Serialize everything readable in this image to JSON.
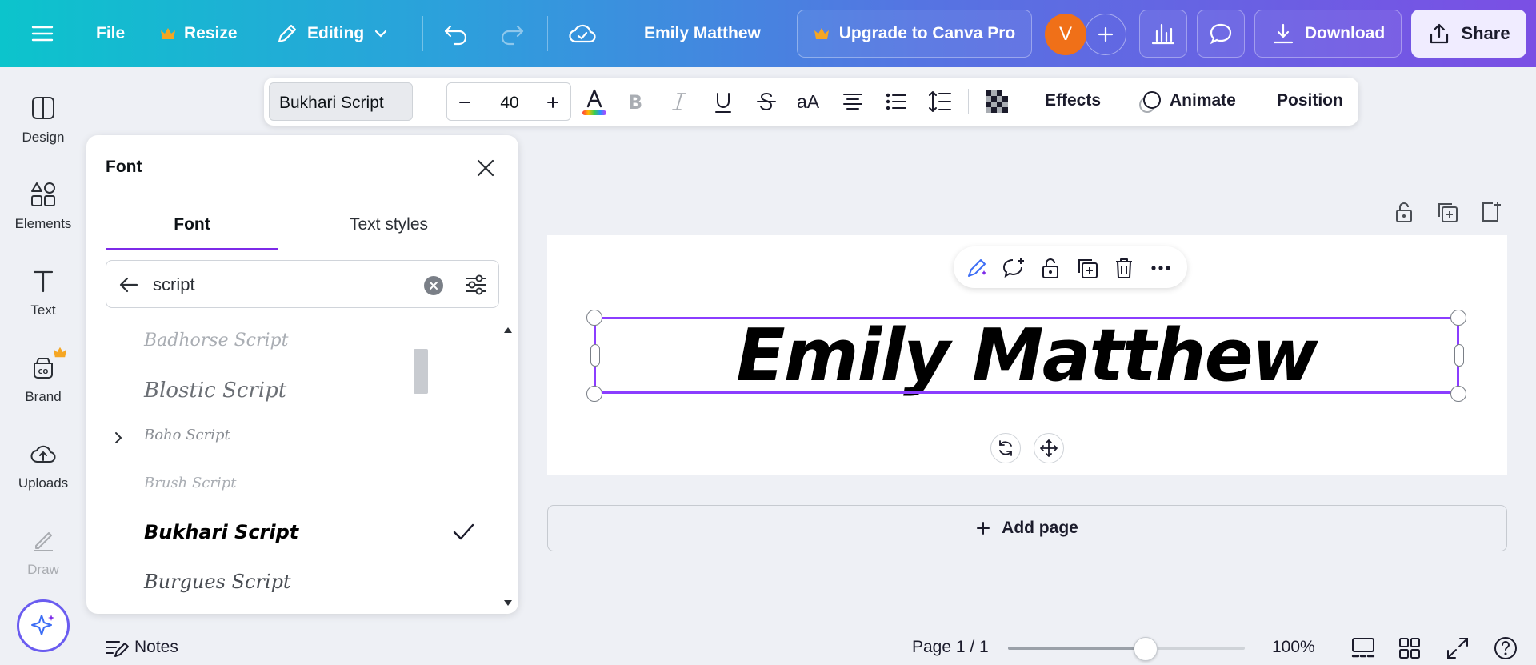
{
  "topbar": {
    "file_label": "File",
    "resize_label": "Resize",
    "editing_label": "Editing",
    "doc_title": "Emily Matthew",
    "upgrade_label": "Upgrade to Canva Pro",
    "avatar_initial": "V",
    "download_label": "Download",
    "share_label": "Share"
  },
  "rail": {
    "design": "Design",
    "elements": "Elements",
    "text": "Text",
    "brand": "Brand",
    "uploads": "Uploads",
    "draw": "Draw"
  },
  "font_panel": {
    "title": "Font",
    "tab_font": "Font",
    "tab_text_styles": "Text styles",
    "search_value": "script",
    "fonts": [
      {
        "name": "Badhorse Script",
        "selected": false
      },
      {
        "name": "Blostic Script",
        "selected": false
      },
      {
        "name": "Boho Script",
        "selected": false
      },
      {
        "name": "Brush Script",
        "selected": false
      },
      {
        "name": "Bukhari Script",
        "selected": true
      },
      {
        "name": "Burgues Script",
        "selected": false
      }
    ]
  },
  "toolbar": {
    "font_name": "Bukhari Script",
    "font_size": "40",
    "case_label": "aA",
    "effects_label": "Effects",
    "animate_label": "Animate",
    "position_label": "Position"
  },
  "canvas": {
    "text": "Emily Matthew",
    "add_page_label": "Add page"
  },
  "footer": {
    "notes_label": "Notes",
    "page_indicator": "Page 1 / 1",
    "zoom_label": "100%",
    "zoom_fraction": 0.58
  },
  "colors": {
    "accent_purple": "#8b3dff",
    "crown_gold": "#f5a623",
    "avatar_orange": "#f07018"
  }
}
